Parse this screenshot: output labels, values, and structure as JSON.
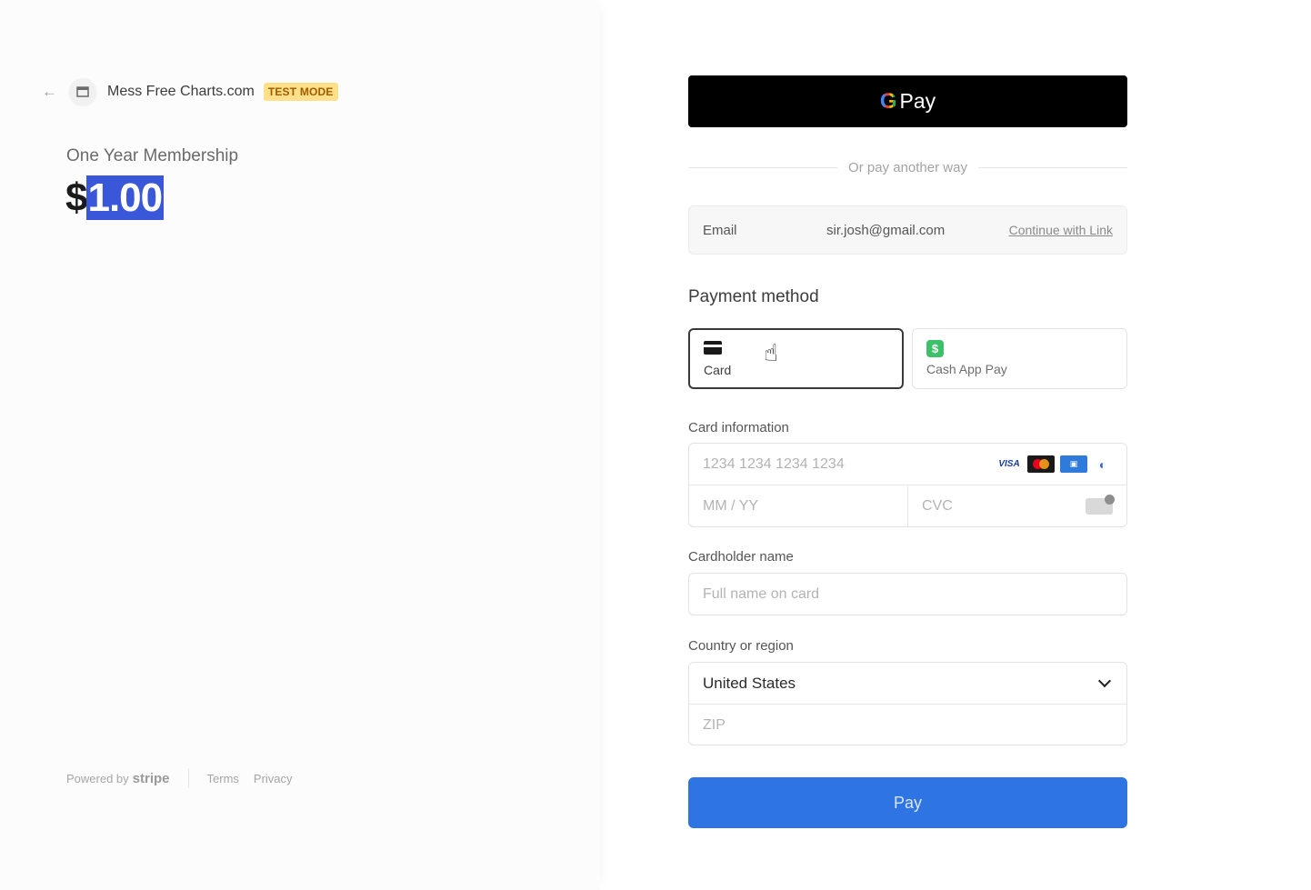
{
  "merchant": {
    "name": "Mess Free Charts.com",
    "test_badge": "TEST MODE"
  },
  "product": {
    "name": "One Year Membership",
    "currency_symbol": "$",
    "amount": "1.00"
  },
  "footer": {
    "powered_by": "Powered by",
    "brand": "stripe",
    "terms": "Terms",
    "privacy": "Privacy"
  },
  "gpay": {
    "g": "G",
    "label": "Pay"
  },
  "divider_text": "Or pay another way",
  "email": {
    "label": "Email",
    "value": "sir.josh@gmail.com",
    "link": "Continue with Link"
  },
  "payment_method": {
    "title": "Payment method",
    "options": [
      {
        "label": "Card",
        "icon": "credit-card-icon",
        "selected": true
      },
      {
        "label": "Cash App Pay",
        "icon": "cash-app-icon",
        "selected": false
      }
    ]
  },
  "card_info": {
    "label": "Card information",
    "number_placeholder": "1234 1234 1234 1234",
    "expiry_placeholder": "MM / YY",
    "cvc_placeholder": "CVC",
    "brands": [
      "VISA",
      "mastercard",
      "amex",
      "diners"
    ]
  },
  "cardholder": {
    "label": "Cardholder name",
    "placeholder": "Full name on card"
  },
  "country": {
    "label": "Country or region",
    "selected": "United States",
    "zip_placeholder": "ZIP"
  },
  "pay_button": "Pay",
  "colors": {
    "accent": "#2e74e2",
    "selection": "#3b57d9",
    "test_badge_bg": "#ffe08a",
    "cash_app": "#3cc068"
  }
}
